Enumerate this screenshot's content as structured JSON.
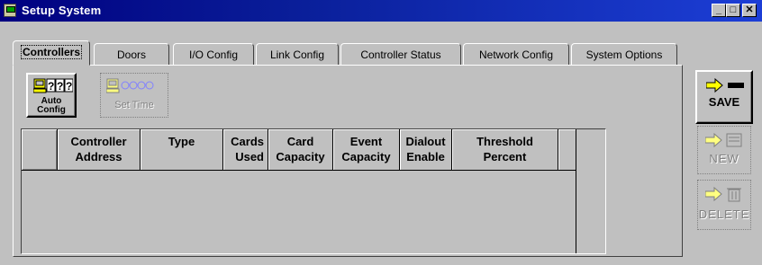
{
  "window": {
    "title": "Setup System",
    "minimize": "_",
    "maximize": "□",
    "close": "✕"
  },
  "tabs": [
    {
      "label": "Controllers",
      "active": true
    },
    {
      "label": "Doors"
    },
    {
      "label": "I/O Config"
    },
    {
      "label": "Link Config"
    },
    {
      "label": "Controller Status"
    },
    {
      "label": "Network Config"
    },
    {
      "label": "System Options"
    }
  ],
  "toolbar": {
    "auto_config": {
      "line1": "Auto",
      "line2": "Config",
      "icon_text": "???"
    },
    "set_time": {
      "label": "Set Time",
      "icon_text": "0000",
      "enabled": false
    }
  },
  "grid": {
    "columns": [
      {
        "line1": "Controller",
        "line2": "Address"
      },
      {
        "line1": "Type",
        "line2": ""
      },
      {
        "line1": "Cards",
        "line2": "Used"
      },
      {
        "line1": "Card",
        "line2": "Capacity"
      },
      {
        "line1": "Event",
        "line2": "Capacity"
      },
      {
        "line1": "Dialout",
        "line2": "Enable"
      },
      {
        "line1": "Threshold",
        "line2": "Percent"
      }
    ],
    "rows": []
  },
  "side": {
    "save": "SAVE",
    "new": "NEW",
    "delete": "DELETE"
  },
  "colors": {
    "titlebar": "#000080",
    "face": "#c0c0c0",
    "arrow": "#ffff00"
  }
}
